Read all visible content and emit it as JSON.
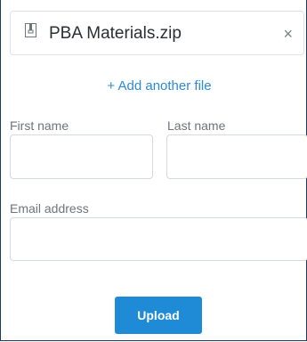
{
  "file": {
    "name": "PBA Materials.zip",
    "icon": "zip-file-icon",
    "remove_glyph": "×"
  },
  "add_file_link": "+ Add another file",
  "form": {
    "first_name": {
      "label": "First name",
      "value": "",
      "placeholder": ""
    },
    "last_name": {
      "label": "Last name",
      "value": "",
      "placeholder": ""
    },
    "email": {
      "label": "Email address",
      "value": "",
      "placeholder": ""
    }
  },
  "upload_label": "Upload",
  "colors": {
    "accent": "#1f8ad6",
    "link": "#2d8ad6",
    "border_frame": "#1f3a5f"
  }
}
